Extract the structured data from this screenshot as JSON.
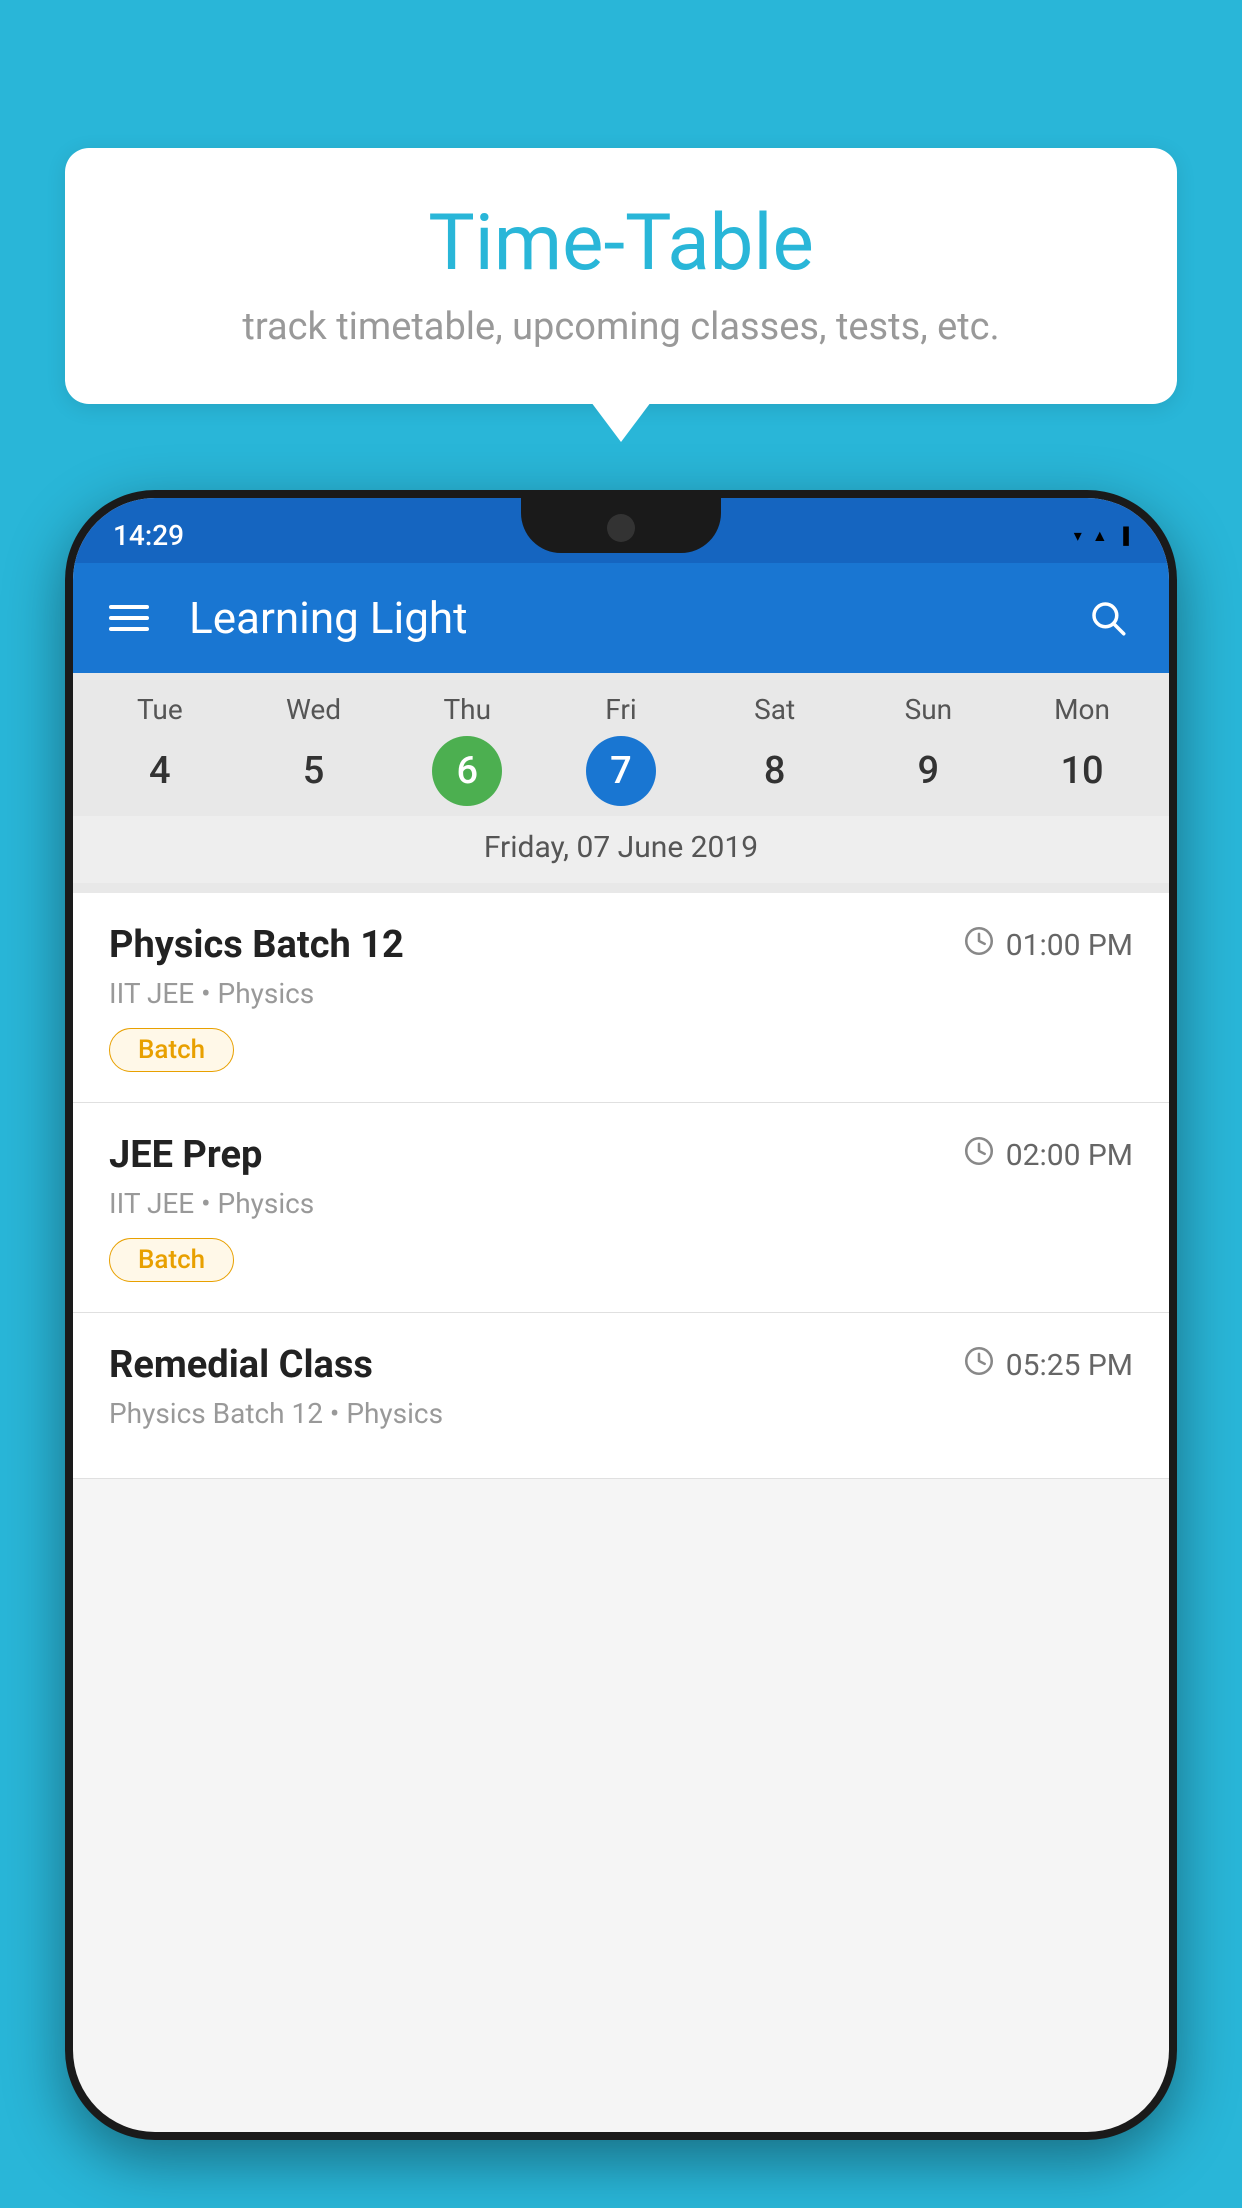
{
  "background": {
    "color": "#29B6D8"
  },
  "tooltip": {
    "title": "Time-Table",
    "subtitle": "track timetable, upcoming classes, tests, etc."
  },
  "phone": {
    "statusBar": {
      "time": "14:29"
    },
    "appBar": {
      "title": "Learning Light"
    },
    "calendar": {
      "days": [
        {
          "name": "Tue",
          "number": "4",
          "state": "normal"
        },
        {
          "name": "Wed",
          "number": "5",
          "state": "normal"
        },
        {
          "name": "Thu",
          "number": "6",
          "state": "today"
        },
        {
          "name": "Fri",
          "number": "7",
          "state": "selected"
        },
        {
          "name": "Sat",
          "number": "8",
          "state": "normal"
        },
        {
          "name": "Sun",
          "number": "9",
          "state": "normal"
        },
        {
          "name": "Mon",
          "number": "10",
          "state": "normal"
        }
      ],
      "selectedDate": "Friday, 07 June 2019"
    },
    "schedule": [
      {
        "title": "Physics Batch 12",
        "time": "01:00 PM",
        "sub": "IIT JEE • Physics",
        "badge": "Batch"
      },
      {
        "title": "JEE Prep",
        "time": "02:00 PM",
        "sub": "IIT JEE • Physics",
        "badge": "Batch"
      },
      {
        "title": "Remedial Class",
        "time": "05:25 PM",
        "sub": "Physics Batch 12 • Physics",
        "badge": ""
      }
    ]
  }
}
